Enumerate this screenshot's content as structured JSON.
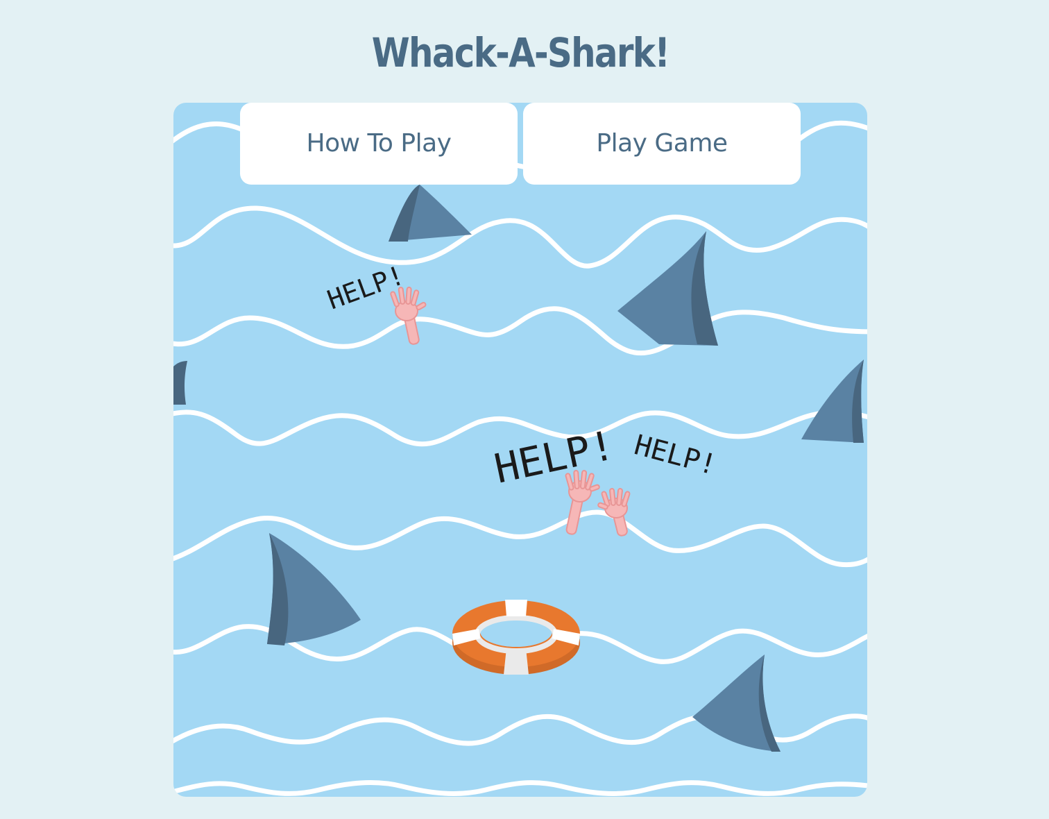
{
  "title": "Whack-A-Shark!",
  "buttons": {
    "how_to_play": "How To Play",
    "play_game": "Play Game"
  },
  "board": {
    "help_texts": [
      "HELP!",
      "HELP!",
      "HELP!"
    ]
  },
  "colors": {
    "background": "#e3f1f4",
    "water": "#a3d8f4",
    "wave": "#ffffff",
    "fin": "#5a82a3",
    "fin_shadow": "#48667f",
    "title": "#4a6b85",
    "lifebuoy": "#e8782e"
  }
}
